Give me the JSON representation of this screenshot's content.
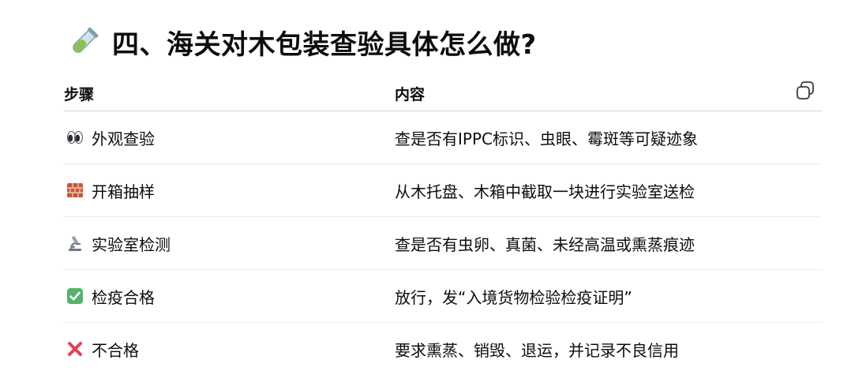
{
  "heading": {
    "icon": "test-tube-icon",
    "title": "四、海关对木包装查验具体怎么做?"
  },
  "table": {
    "copy_icon": "copy-icon",
    "headers": [
      "步骤",
      "内容"
    ],
    "rows": [
      {
        "icon": "eyes-icon",
        "step": "外观查验",
        "content": "查是否有IPPC标识、虫眼、霉斑等可疑迹象"
      },
      {
        "icon": "brick-icon",
        "step": "开箱抽样",
        "content": "从木托盘、木箱中截取一块进行实验室送检"
      },
      {
        "icon": "microscope-icon",
        "step": "实验室检测",
        "content": "查是否有虫卵、真菌、未经高温或熏蒸痕迹"
      },
      {
        "icon": "check-mark-button-icon",
        "step": "检疫合格",
        "content": "放行，发“入境货物检验检疫证明”"
      },
      {
        "icon": "cross-mark-icon",
        "step": "不合格",
        "content": "要求熏蒸、销毁、退运，并记录不良信用"
      }
    ]
  },
  "colors": {
    "text": "#0d0d0d",
    "divider": "#ececec",
    "check_green": "#56b36a",
    "cross_red": "#e5414f",
    "brick": "#c8563a"
  }
}
